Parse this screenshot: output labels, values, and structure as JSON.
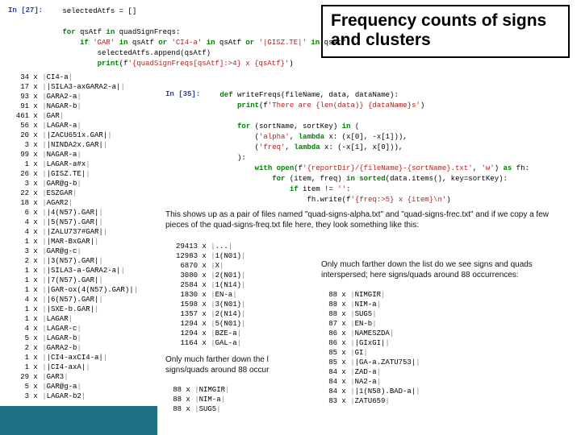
{
  "callout": "Frequency counts of signs and clusters",
  "cell1": {
    "prompt": "In [27]:",
    "lines": [
      {
        "pre": "",
        "kw": "",
        "mid": "selectedAtfs = []",
        "end": ""
      },
      {
        "pre": "",
        "kw": "",
        "mid": "",
        "end": ""
      },
      {
        "pre": "",
        "kw": "for",
        "mid": " qsAtf ",
        "kw2": "in",
        "mid2": " quadSignFreqs:",
        "end": ""
      },
      {
        "pre": "    ",
        "kw": "if",
        "mid": " ",
        "str": "'GAR'",
        "mid2": " ",
        "kw2": "in",
        "mid3": " qsAtf ",
        "kw3": "or",
        "mid4": " ",
        "str2": "'CI4-a'",
        "mid5": " ",
        "kw4": "in",
        "mid6": " qsAtf ",
        "kw5": "or",
        "mid7": " ",
        "str3": "'|GISZ.TE|'",
        "mid8": " ",
        "kw6": "in",
        "mid9": " qsAtf:",
        "end": ""
      },
      {
        "pre": "        ",
        "kw": "",
        "mid": "selectedAtfs.append(qsAtf)",
        "end": ""
      },
      {
        "pre": "        ",
        "kw": "",
        "mid": "",
        "call": "print",
        "mid2": "(f",
        "str": "'{quadSignFreqs[qsAtf]:>4} x {qsAtf}'",
        "mid3": ")",
        "end": ""
      }
    ]
  },
  "leftlist": [
    [
      "34",
      "CI4-a"
    ],
    [
      "17",
      "|SILA3-axGARA2-a|"
    ],
    [
      "93",
      "GARA2-a"
    ],
    [
      "91",
      "NAGAR-b"
    ],
    [
      "461",
      "GAR"
    ],
    [
      "56",
      "LAGAR-a"
    ],
    [
      "20",
      "|ZACU651x.GAR|"
    ],
    [
      "3",
      "|NINDA2x.GAR|"
    ],
    [
      "99",
      "NAGAR-a"
    ],
    [
      "1",
      "LAGAR-a#x"
    ],
    [
      "26",
      "|GISZ.TE|"
    ],
    [
      "3",
      "GAR@g-b"
    ],
    [
      "22",
      "ESZGAR"
    ],
    [
      "18",
      "AGAR2"
    ],
    [
      "6",
      "|4(N57).GAR|"
    ],
    [
      "4",
      "|5(N57).GAR|"
    ],
    [
      "4",
      "|ZALU737#GAR|"
    ],
    [
      "1",
      "|MAR-BxGAR|"
    ],
    [
      "3",
      "GAR@g-c"
    ],
    [
      "2",
      "|3(N57).GAR|"
    ],
    [
      "1",
      "|SILA3-a-GARA2-a|"
    ],
    [
      "1",
      "|7(N57).GAR|"
    ],
    [
      "1",
      "|GAR-ox(4(N57).GAR)|"
    ],
    [
      "4",
      "|6(N57).GAR|"
    ],
    [
      "1",
      "|SXE-b.GAR|"
    ],
    [
      "1",
      "LAGAR"
    ],
    [
      "4",
      "LAGAR-c"
    ],
    [
      "5",
      "LAGAR-b"
    ],
    [
      "2",
      "GARA2-b"
    ],
    [
      "1",
      "|CI4-axCI4-a|"
    ],
    [
      "1",
      "|CI4-axA|"
    ],
    [
      "29",
      "GAR3"
    ],
    [
      "5",
      "GAR@g-a"
    ],
    [
      "3",
      "LAGAR-b2"
    ]
  ],
  "cell2": {
    "prompt": "In [35]:",
    "lines": [
      "def writeFreqs(fileName, data, dataName):",
      "    print(f'There are {len(data)} {dataName}s')",
      "",
      "    for (sortName, sortKey) in (",
      "        ('alpha', lambda x: (x[0], -x[1])),",
      "        ('freq', lambda x: (-x[1], x[0])),",
      "    ):",
      "        with open(f'{reportDir}/{fileName}-{sortName}.txt', 'w') as fh:",
      "            for (item, freq) in sorted(data.items(), key=sortKey):",
      "                if item != '':",
      "                    fh.write(f'{freq:>5} x {item}\\n')"
    ]
  },
  "para1": "This shows up as a pair of files named \"quad-signs-alpha.txt\" and \"quad-signs-frec.txt\" and if we copy a few pieces of the quad-signs-freq.txt file here, they look something like this:",
  "midlist": [
    [
      "29413",
      "..."
    ],
    [
      "12983",
      "1(N01)"
    ],
    [
      "6870",
      "X"
    ],
    [
      "3080",
      "2(N01)"
    ],
    [
      "2584",
      "1(N14)"
    ],
    [
      "1830",
      "EN-a"
    ],
    [
      "1598",
      "3(N01)"
    ],
    [
      "1357",
      "2(N14)"
    ],
    [
      "1294",
      "5(N01)"
    ],
    [
      "1294",
      "BZE-a"
    ],
    [
      "1164",
      "GAL-a"
    ]
  ],
  "para2": "Only much farther down the l signs/quads around 88 occur",
  "mblist": [
    [
      "88",
      "NIMGIR"
    ],
    [
      "88",
      "NIM-a"
    ],
    [
      "88",
      "SUG5"
    ]
  ],
  "para3": "Only much farther down the list do we see signs and quads interspersed; here signs/quads around 88 occurrences:",
  "rightlist": [
    [
      "88",
      "NIMGIR"
    ],
    [
      "88",
      "NIM-a"
    ],
    [
      "88",
      "SUG5"
    ],
    [
      "87",
      "EN-b"
    ],
    [
      "86",
      "NAMESZDA"
    ],
    [
      "86",
      "|GIxGI|"
    ],
    [
      "85",
      "GI"
    ],
    [
      "85",
      "|GA-a.ZATU753|"
    ],
    [
      "84",
      "ZAD-a"
    ],
    [
      "84",
      "NA2-a"
    ],
    [
      "84",
      "|1(N58).BAD-a|"
    ],
    [
      "83",
      "ZATU659"
    ]
  ]
}
